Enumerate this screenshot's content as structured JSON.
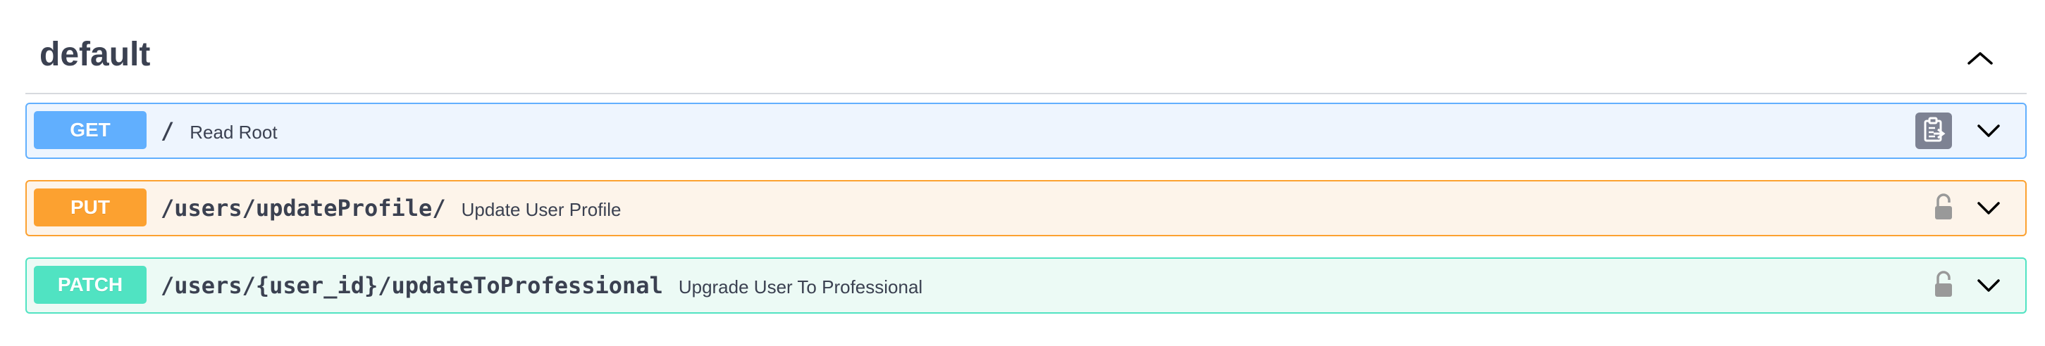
{
  "tag": {
    "title": "default",
    "collapse_icon": "chevron-up-icon"
  },
  "operations": [
    {
      "method": "GET",
      "path": "/",
      "summary": "Read Root",
      "color": "#61affe",
      "right_icon": "copy-to-clipboard-icon",
      "toggle_icon": "chevron-down-icon"
    },
    {
      "method": "PUT",
      "path": "/users/updateProfile/",
      "summary": "Update User Profile",
      "color": "#fca130",
      "right_icon": "unlocked-icon",
      "toggle_icon": "chevron-down-icon"
    },
    {
      "method": "PATCH",
      "path": "/users/{user_id}/updateToProfessional",
      "summary": "Upgrade User To Professional",
      "color": "#50e3c2",
      "right_icon": "unlocked-icon",
      "toggle_icon": "chevron-down-icon"
    }
  ]
}
